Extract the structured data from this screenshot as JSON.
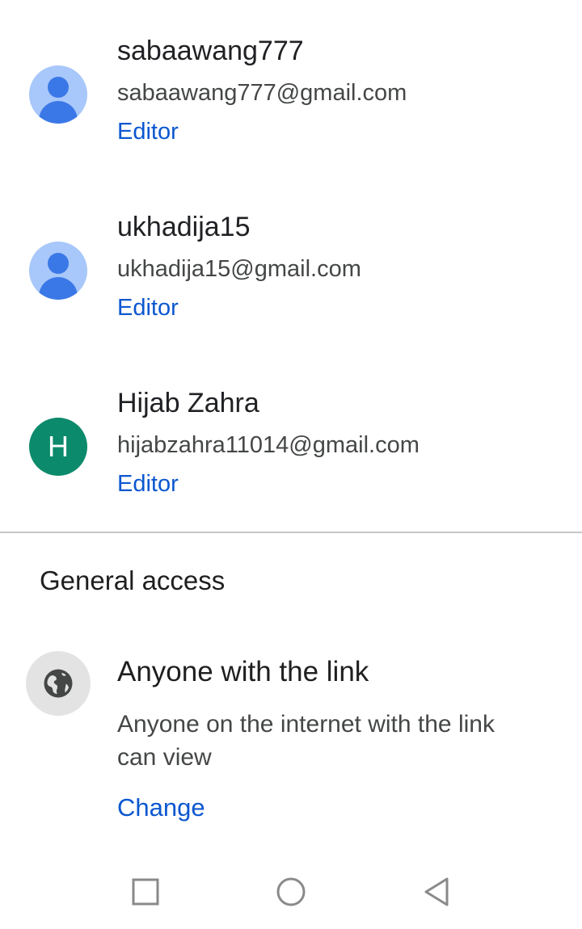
{
  "people": [
    {
      "name": "sabaawang777",
      "email": "sabaawang777@gmail.com",
      "role": "Editor",
      "avatar": "default-person-icon"
    },
    {
      "name": "ukhadija15",
      "email": "ukhadija15@gmail.com",
      "role": "Editor",
      "avatar": "default-person-icon"
    },
    {
      "name": "Hijab Zahra",
      "email": "hijabzahra11014@gmail.com",
      "role": "Editor",
      "avatar_letter": "H"
    }
  ],
  "general_access": {
    "section_title": "General access",
    "icon": "globe-icon",
    "title": "Anyone with the link",
    "description": "Anyone on the internet with the link can view",
    "change_label": "Change"
  },
  "nav": {
    "buttons": [
      "recents-square-icon",
      "home-circle-icon",
      "back-triangle-icon"
    ]
  },
  "colors": {
    "link_blue": "#0b57d0",
    "avatar_default_bg": "#a8c7fa",
    "avatar_default_fg": "#3b78e7",
    "avatar_letter_bg": "#0c8a6c",
    "globe_bg": "#e3e3e3"
  }
}
